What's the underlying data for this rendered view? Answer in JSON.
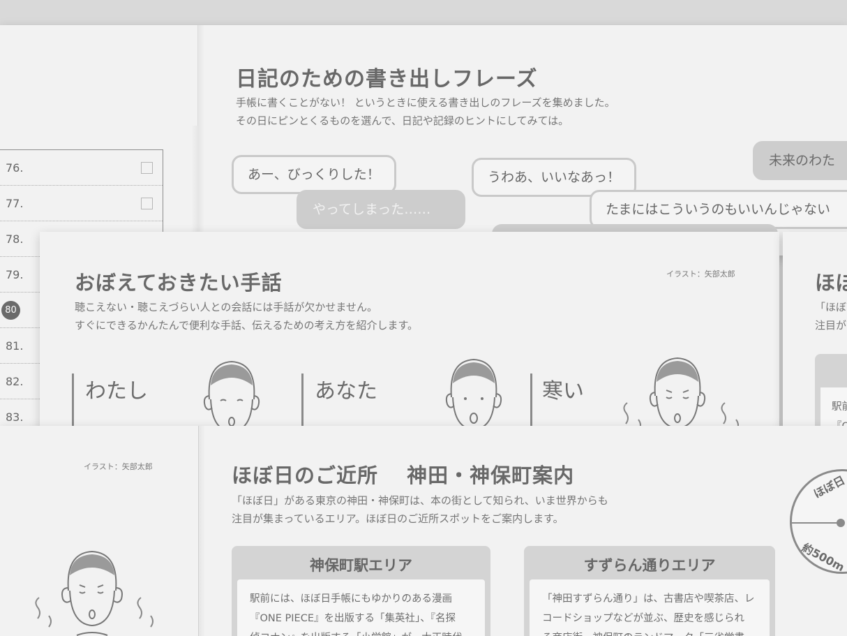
{
  "diary": {
    "title": "日記のための書き出しフレーズ",
    "lead": [
      "手帳に書くことがない！ というときに使える書き出しのフレーズを集めました。",
      "その日にピンとくるものを選んで、日記や記録のヒントにしてみては。"
    ],
    "phrases": [
      "あー、びっくりした！",
      "やってしまった……",
      "うわあ、いいなあっ！",
      "たまにはこういうのもいいんじゃない",
      "未来のわた"
    ]
  },
  "checklist": {
    "items": [
      "76.",
      "77.",
      "78.",
      "79.",
      "80",
      "81.",
      "82.",
      "83."
    ]
  },
  "sign": {
    "title": "おぼえておきたい手話",
    "credit": "イラスト：矢部太郎",
    "lead": [
      "聴こえない・聴こえづらい人との会話には手話が欠かせません。",
      "すぐにできるかんたんで便利な手話、伝えるための考え方を紹介します。"
    ],
    "words": [
      "わたし",
      "あなた",
      "寒い"
    ]
  },
  "peek_right": {
    "title": "ほぼ",
    "lines": [
      "「ほぼ",
      "注目が"
    ],
    "box_lines": [
      "駅前",
      "『O"
    ]
  },
  "lower_left": {
    "credit": "イラスト：矢部太郎"
  },
  "kanda": {
    "title": "ほぼ日のご近所　 神田・神保町案内",
    "lead": [
      "「ほぼ日」がある東京の神田・神保町は、本の街として知られ、いま世界からも",
      "注目が集まっているエリア。ほぼ日のご近所スポットをご案内します。"
    ],
    "badge": {
      "top": "ほぼ日",
      "bottom": "約500m"
    },
    "areas": [
      {
        "title": "神保町駅エリア",
        "lines": [
          "駅前には、ほぼ日手帳にもゆかりのある漫画",
          "『ONE PIECE』を出版する「集英社」、『名探",
          "偵コナン』を出版する「小学館」が、大正時代"
        ]
      },
      {
        "title": "すずらん通りエリア",
        "lines": [
          "「神田すずらん通り」は、古書店や喫茶店、レ",
          "コードショップなどが並ぶ、歴史を感じられ",
          "る商店街。神保町のランドマーク「三省堂書"
        ]
      }
    ]
  }
}
